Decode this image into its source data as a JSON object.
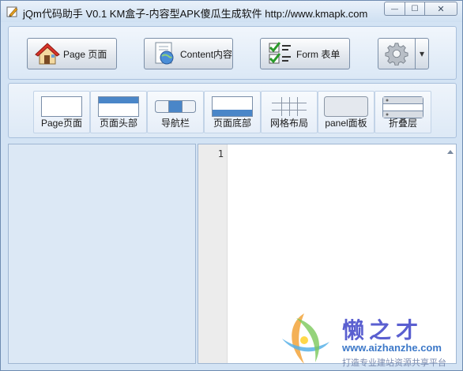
{
  "window": {
    "title": "jQm代码助手 V0.1   KM盒子-内容型APK傻瓜生成软件 http://www.kmapk.com",
    "min_glyph": "—",
    "max_glyph": "☐",
    "close_glyph": "✕"
  },
  "toolbar": {
    "page_label": "Page 页面",
    "content_label": "Content内容",
    "form_label": "Form 表单",
    "dropdown_glyph": "▾"
  },
  "components": [
    {
      "label": "Page页面",
      "icon": "page-icon"
    },
    {
      "label": "页面头部",
      "icon": "header-icon"
    },
    {
      "label": "导航栏",
      "icon": "navbar-icon"
    },
    {
      "label": "页面底部",
      "icon": "footer-icon"
    },
    {
      "label": "网格布局",
      "icon": "grid-icon"
    },
    {
      "label": "panel面板",
      "icon": "panel-icon"
    },
    {
      "label": "折叠层",
      "icon": "collapsible-icon"
    }
  ],
  "editor": {
    "line_numbers": [
      "1"
    ]
  },
  "watermark": {
    "brand": "懒之才",
    "url": "www.aizhanzhe.com",
    "slogan": "打造专业建站资源共享平台"
  },
  "colors": {
    "accent": "#4a86c8",
    "panel_bg": "#dce8f5",
    "watermark_brand": "#5a5fd0"
  }
}
